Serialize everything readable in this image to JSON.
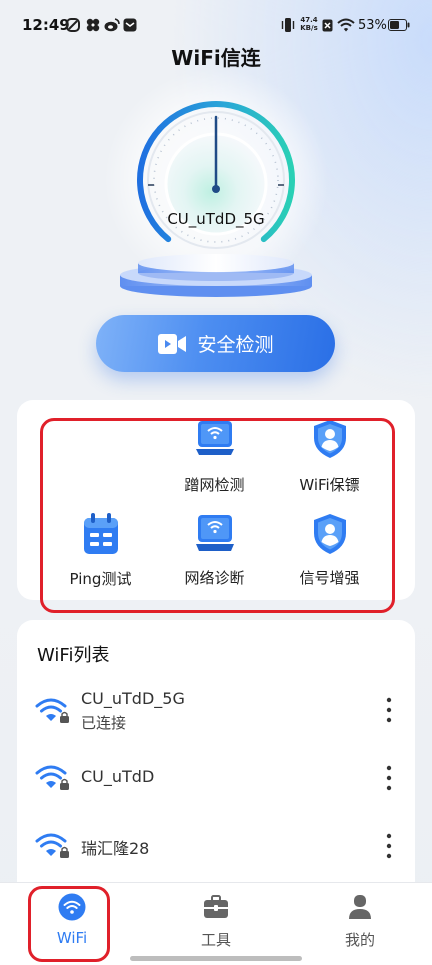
{
  "status_bar": {
    "time": "12:49",
    "net_speed_value": "47.4",
    "net_speed_unit": "KB/s",
    "battery": "53%",
    "icons": [
      "app-icon",
      "clover-icon",
      "weibo-icon",
      "message-icon",
      "vibrate-icon",
      "no-sim-icon",
      "wifi-signal-icon",
      "battery-icon"
    ]
  },
  "header": {
    "title": "WiFi信连"
  },
  "gauge": {
    "ssid": "CU_uTdD_5G"
  },
  "scan_button": {
    "label": "安全检测",
    "icon": "video-camera-icon"
  },
  "tools": {
    "items": [
      {
        "label": "蹭网检测",
        "icon": "laptop-wifi-icon"
      },
      {
        "label": "WiFi保镖",
        "icon": "shield-person-icon"
      },
      {
        "label": "Ping测试",
        "icon": "calendar-icon"
      },
      {
        "label": "网络诊断",
        "icon": "laptop-wifi-icon"
      },
      {
        "label": "信号增强",
        "icon": "shield-person-icon"
      }
    ]
  },
  "wifi_list": {
    "title": "WiFi列表",
    "networks": [
      {
        "ssid": "CU_uTdD_5G",
        "status": "已连接",
        "locked": true
      },
      {
        "ssid": "CU_uTdD",
        "locked": true
      },
      {
        "ssid": "瑞汇隆28",
        "locked": true
      }
    ]
  },
  "nav": {
    "items": [
      {
        "label": "WiFi",
        "icon": "wifi-icon",
        "active": true
      },
      {
        "label": "工具",
        "icon": "toolbox-icon",
        "active": false
      },
      {
        "label": "我的",
        "icon": "person-icon",
        "active": false
      }
    ]
  },
  "colors": {
    "accent": "#2f7cf2",
    "annotation": "#e0202a",
    "arc_start": "#1f6fe0",
    "arc_end": "#2ad0b5"
  }
}
